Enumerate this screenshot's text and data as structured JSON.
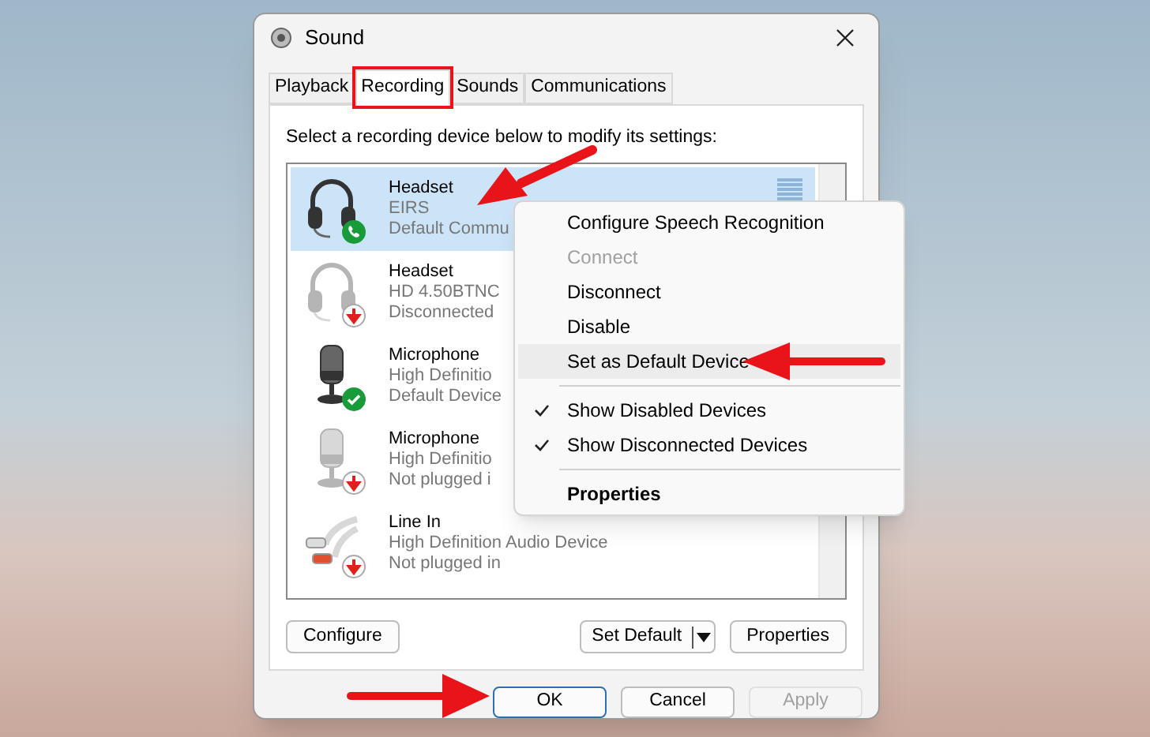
{
  "window": {
    "title": "Sound"
  },
  "tabs": [
    {
      "label": "Playback",
      "selected": false,
      "annotated": false
    },
    {
      "label": "Recording",
      "selected": true,
      "annotated": true
    },
    {
      "label": "Sounds",
      "selected": false,
      "annotated": false
    },
    {
      "label": "Communications",
      "selected": false,
      "annotated": false
    }
  ],
  "instruction": "Select a recording device below to modify its settings:",
  "devices": [
    {
      "kind": "headset",
      "badge": {
        "kind": "phone"
      },
      "name": "Headset",
      "line_2": "EIRS",
      "line_3": "Default Commu",
      "selected": true,
      "dimmed": false
    },
    {
      "kind": "headset",
      "badge": {
        "kind": "down"
      },
      "name": "Headset",
      "line_2": "HD 4.50BTNC",
      "line_3": "Disconnected",
      "selected": false,
      "dimmed": true
    },
    {
      "kind": "microphone",
      "badge": {
        "kind": "check"
      },
      "name": "Microphone",
      "line_2": "High Definitio",
      "line_3": "Default Device",
      "selected": false,
      "dimmed": false
    },
    {
      "kind": "microphone",
      "badge": {
        "kind": "down"
      },
      "name": "Microphone",
      "line_2": "High Definitio",
      "line_3": "Not plugged i",
      "selected": false,
      "dimmed": true
    },
    {
      "kind": "line-in",
      "badge": {
        "kind": "down"
      },
      "name": "Line In",
      "line_2": "High Definition Audio Device",
      "line_3": "Not plugged in",
      "selected": false,
      "dimmed": true
    }
  ],
  "context_menu": [
    {
      "kind": "item",
      "label": "Configure Speech Recognition",
      "disabled": false,
      "checked": false,
      "bold": false,
      "selected": false
    },
    {
      "kind": "item",
      "label": "Connect",
      "disabled": true,
      "checked": false,
      "bold": false,
      "selected": false
    },
    {
      "kind": "item",
      "label": "Disconnect",
      "disabled": false,
      "checked": false,
      "bold": false,
      "selected": false
    },
    {
      "kind": "item",
      "label": "Disable",
      "disabled": false,
      "checked": false,
      "bold": false,
      "selected": false
    },
    {
      "kind": "item",
      "label": "Set as Default Device",
      "disabled": false,
      "checked": false,
      "bold": false,
      "selected": true
    },
    {
      "kind": "separator"
    },
    {
      "kind": "item",
      "label": "Show Disabled Devices",
      "disabled": false,
      "checked": true,
      "bold": false,
      "selected": false
    },
    {
      "kind": "item",
      "label": "Show Disconnected Devices",
      "disabled": false,
      "checked": true,
      "bold": false,
      "selected": false
    },
    {
      "kind": "separator"
    },
    {
      "kind": "item",
      "label": "Properties",
      "disabled": false,
      "checked": false,
      "bold": true,
      "selected": false
    }
  ],
  "panel_buttons": [
    {
      "label": "Configure",
      "kind": "plain"
    },
    {
      "label": "Set Default",
      "kind": "split"
    },
    {
      "label": "Properties",
      "kind": "plain"
    }
  ],
  "dialog_buttons": [
    {
      "label": "OK",
      "disabled": false,
      "default": true
    },
    {
      "label": "Cancel",
      "disabled": false,
      "default": false
    },
    {
      "label": "Apply",
      "disabled": true,
      "default": false
    }
  ]
}
